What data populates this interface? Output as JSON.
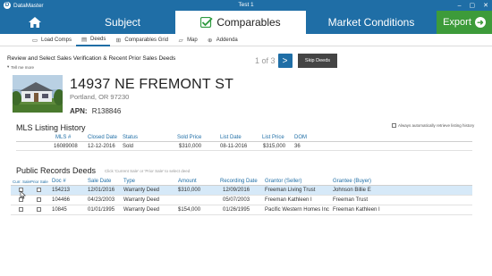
{
  "window": {
    "app_name": "DataMaster",
    "title": "Test 1",
    "controls": [
      "–",
      "▢",
      "✕"
    ]
  },
  "nav": {
    "home_icon": "home-icon",
    "tabs": [
      {
        "label": "Subject"
      },
      {
        "label": "Comparables"
      },
      {
        "label": "Market Conditions"
      }
    ],
    "export_label": "Export"
  },
  "subtoolbar": {
    "items": [
      {
        "label": "Load Comps",
        "icon": "folder-icon"
      },
      {
        "label": "Deeds",
        "icon": "document-icon"
      },
      {
        "label": "Comparables Grid",
        "icon": "grid-icon"
      },
      {
        "label": "Map",
        "icon": "map-icon"
      },
      {
        "label": "Addenda",
        "icon": "add-icon"
      }
    ]
  },
  "review": {
    "title": "Review and Select Sales Verification & Recent Prior Sales Deeds",
    "tell_more": "Tell me more",
    "pager_text": "1 of 3",
    "next_icon": ">",
    "skip_label": "Skip Deeds"
  },
  "property": {
    "address": "14937 NE FREMONT ST",
    "city": "Portland, OR 97230",
    "apn_label": "APN:",
    "apn_value": "R138846"
  },
  "mls": {
    "title": "MLS Listing History",
    "always_retrieve": "Always automatically retrieve listing history",
    "headers": [
      "MLS #",
      "Closed Date",
      "Status",
      "Sold Price",
      "List Date",
      "List Price",
      "DOM"
    ],
    "rows": [
      [
        "16089008",
        "12-12-2016",
        "Sold",
        "$310,000",
        "08-11-2016",
        "$315,000",
        "36"
      ]
    ]
  },
  "public_records": {
    "title": "Public Records Deeds",
    "hint": "Click 'Current Sale' or 'Prior Sale' to select deed",
    "headers": [
      "Curr. Sale",
      "Prior Sale",
      "Doc #",
      "Sale Date",
      "Type",
      "Amount",
      "Recording Date",
      "Grantor (Seller)",
      "Grantee (Buyer)"
    ],
    "rows": [
      [
        "154213",
        "12/01/2016",
        "Warranty Deed",
        "$310,000",
        "12/09/2016",
        "Freeman Living Trust",
        "Johnson Billie E"
      ],
      [
        "104466",
        "04/23/2003",
        "Warranty Deed",
        "",
        "05/07/2003",
        "Freeman Kathleen I",
        "Freeman Trust"
      ],
      [
        "10845",
        "01/01/1995",
        "Warranty Deed",
        "$154,000",
        "01/26/1995",
        "Pacific Western Homes Inc",
        "Freeman Kathleen I"
      ]
    ]
  },
  "colors": {
    "brand_blue": "#1f6ea6",
    "export_green": "#3d9b3a",
    "selected_row": "#d6e9f8",
    "check_green": "#2e9a3f"
  }
}
